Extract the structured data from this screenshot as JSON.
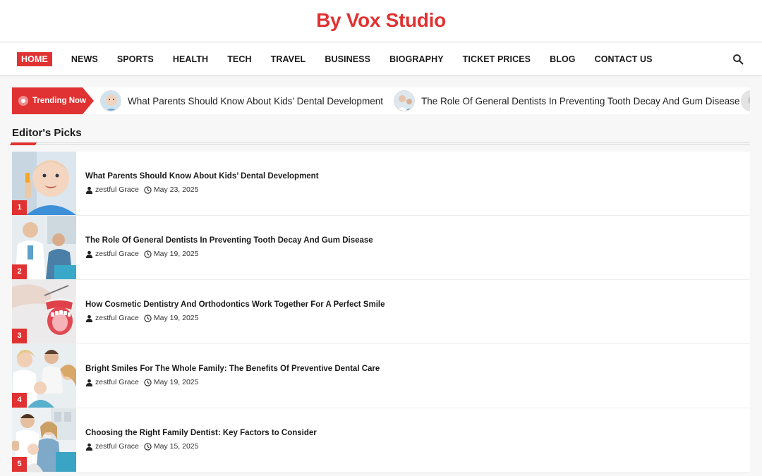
{
  "site": {
    "title": "By Vox Studio",
    "accent": "#e03232"
  },
  "nav": {
    "items": [
      {
        "label": "HOME"
      },
      {
        "label": "NEWS"
      },
      {
        "label": "SPORTS"
      },
      {
        "label": "HEALTH"
      },
      {
        "label": "TECH"
      },
      {
        "label": "TRAVEL"
      },
      {
        "label": "BUSINESS"
      },
      {
        "label": "BIOGRAPHY"
      },
      {
        "label": "TICKET PRICES"
      },
      {
        "label": "BLOG"
      },
      {
        "label": "CONTACT US"
      }
    ],
    "search_icon": "search-icon"
  },
  "ticker": {
    "label": "Trending Now",
    "items": [
      {
        "title": "What Parents Should Know About Kids’ Dental Development"
      },
      {
        "title": "The Role Of General Dentists In Preventing Tooth Decay And Gum Disease"
      }
    ]
  },
  "editors_picks": {
    "title": "Editor's Picks",
    "items": [
      {
        "rank": "1",
        "title": "What Parents Should Know About Kids’ Dental Development",
        "author": "zestful Grace",
        "date": "May 23, 2025"
      },
      {
        "rank": "2",
        "title": "The Role Of General Dentists In Preventing Tooth Decay And Gum Disease",
        "author": "zestful Grace",
        "date": "May 19, 2025"
      },
      {
        "rank": "3",
        "title": "How Cosmetic Dentistry And Orthodontics Work Together For A Perfect Smile",
        "author": "zestful Grace",
        "date": "May 19, 2025"
      },
      {
        "rank": "4",
        "title": "Bright Smiles For The Whole Family: The Benefits Of Preventive Dental Care",
        "author": "zestful Grace",
        "date": "May 19, 2025"
      },
      {
        "rank": "5",
        "title": "Choosing the Right Family Dentist: Key Factors to Consider",
        "author": "zestful Grace",
        "date": "May 15, 2025"
      }
    ]
  }
}
